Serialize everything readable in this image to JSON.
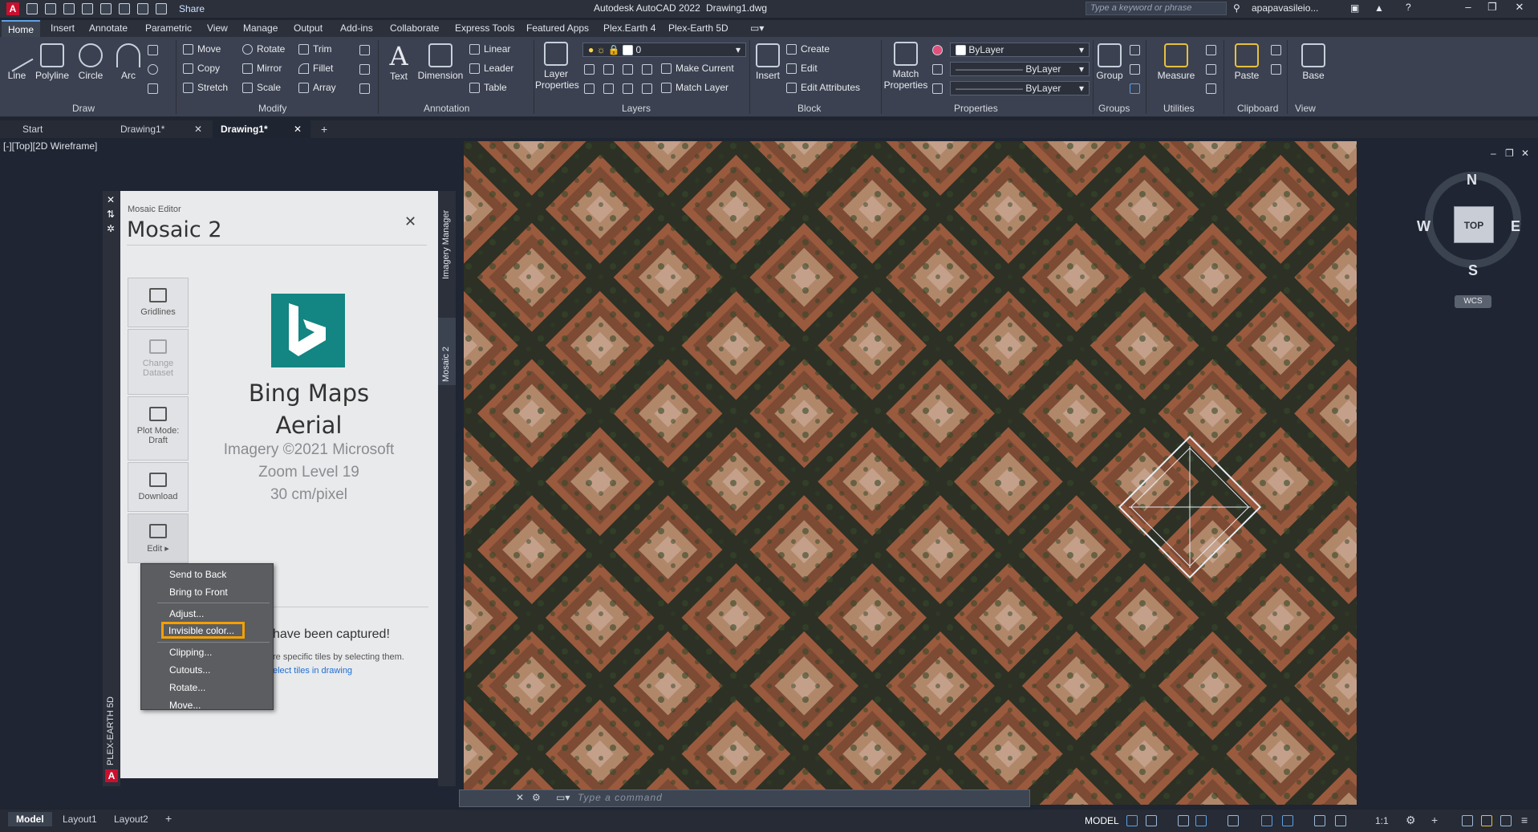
{
  "titlebar": {
    "share_label": "Share",
    "app_title": "Autodesk AutoCAD 2022",
    "file_name": "Drawing1.dwg",
    "search_placeholder": "Type a keyword or phrase",
    "user_name": "apapavasileio..."
  },
  "ribbon_tabs": [
    "Home",
    "Insert",
    "Annotate",
    "Parametric",
    "View",
    "Manage",
    "Output",
    "Add-ins",
    "Collaborate",
    "Express Tools",
    "Featured Apps",
    "Plex.Earth 4",
    "Plex-Earth 5D"
  ],
  "ribbon": {
    "draw": {
      "title": "Draw",
      "line": "Line",
      "polyline": "Polyline",
      "circle": "Circle",
      "arc": "Arc"
    },
    "modify": {
      "title": "Modify",
      "move": "Move",
      "rotate": "Rotate",
      "trim": "Trim",
      "copy": "Copy",
      "mirror": "Mirror",
      "fillet": "Fillet",
      "stretch": "Stretch",
      "scale": "Scale",
      "array": "Array"
    },
    "annotation": {
      "title": "Annotation",
      "text": "Text",
      "dimension": "Dimension",
      "linear": "Linear",
      "leader": "Leader",
      "table": "Table"
    },
    "layers": {
      "title": "Layers",
      "layer_properties": "Layer Properties",
      "current_layer": "0",
      "make_current": "Make Current",
      "match_layer": "Match Layer"
    },
    "block": {
      "title": "Block",
      "insert": "Insert",
      "create": "Create",
      "edit": "Edit",
      "edit_attributes": "Edit Attributes"
    },
    "properties": {
      "title": "Properties",
      "match_properties": "Match Properties",
      "color": "ByLayer",
      "linetype": "ByLayer",
      "lineweight": "ByLayer"
    },
    "groups": {
      "title": "Groups",
      "group": "Group"
    },
    "utilities": {
      "title": "Utilities",
      "measure": "Measure"
    },
    "clipboard": {
      "title": "Clipboard",
      "paste": "Paste"
    },
    "view": {
      "title": "View",
      "base": "Base"
    }
  },
  "doc_tabs": [
    "Start",
    "Drawing1*",
    "Drawing1*"
  ],
  "viewport_label": "[-][Top][2D Wireframe]",
  "viewcube": {
    "n": "N",
    "s": "S",
    "e": "E",
    "w": "W",
    "top": "TOP",
    "wcs": "WCS"
  },
  "plex_panel": {
    "rail_label": "PLEX-EARTH 5D",
    "side_tabs": [
      "Imagery Manager",
      "Mosaic 2"
    ],
    "subtitle": "Mosaic Editor",
    "title": "Mosaic 2",
    "tools": [
      {
        "label": "Gridlines",
        "enabled": true
      },
      {
        "label": "Change Dataset",
        "enabled": false
      },
      {
        "label": "Plot Mode: Draft",
        "enabled": true
      },
      {
        "label": "Download",
        "enabled": true
      },
      {
        "label": "Edit ▸",
        "enabled": true
      }
    ],
    "provider_line1": "Bing Maps",
    "provider_line2": "Aerial",
    "copyright": "Imagery ©2021 Microsoft",
    "zoom_level": "Zoom Level 19",
    "resolution": "30 cm/pixel",
    "captured_msg": "have been captured!",
    "select_msg": "re specific tiles by selecting them.",
    "select_link": "elect tiles in drawing"
  },
  "context_menu": {
    "items": [
      "Send to Back",
      "Bring to Front",
      "Adjust...",
      "Invisible color...",
      "Clipping...",
      "Cutouts...",
      "Rotate...",
      "Move..."
    ],
    "highlighted": "Invisible color...",
    "highlight_color": "#f5a000"
  },
  "command_line": {
    "placeholder": "Type a command"
  },
  "status_bar": {
    "layout_tabs": [
      "Model",
      "Layout1",
      "Layout2"
    ],
    "model_label": "MODEL",
    "scale": "1:1"
  }
}
